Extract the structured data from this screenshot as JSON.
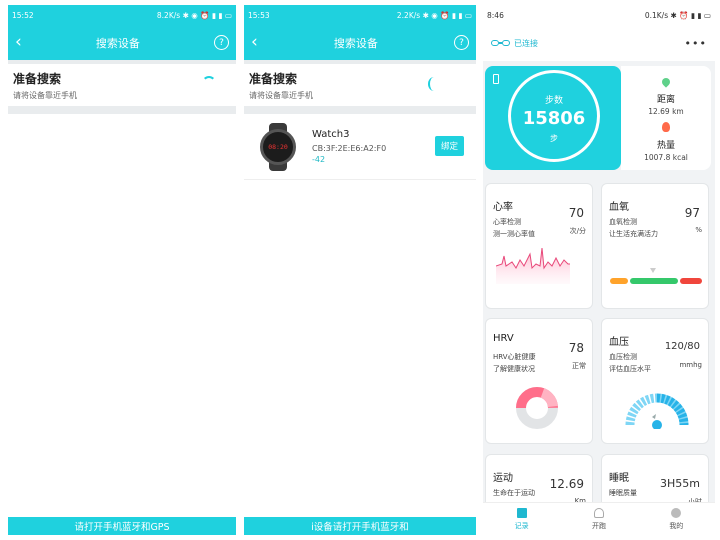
{
  "screen1": {
    "status_time": "15:52",
    "status_right": "8.2K/s ✱ ◉ ⏰ ▮ ▮ ▭",
    "title": "搜索设备",
    "prep_title": "准备搜索",
    "prep_sub": "请将设备靠近手机",
    "bottom_text": "请打开手机蓝牙和GPS"
  },
  "screen2": {
    "status_time": "15:53",
    "status_right": "2.2K/s ✱ ◉ ⏰ ▮ ▮ ▭",
    "title": "搜索设备",
    "prep_title": "准备搜索",
    "prep_sub": "请将设备靠近手机",
    "device": {
      "name": "Watch3",
      "mac": "CB:3F:2E:E6:A2:F0",
      "rssi": "-42",
      "watch_face": "08:20",
      "bind_label": "绑定"
    },
    "bottom_text": "i设备请打开手机蓝牙和"
  },
  "screen3": {
    "status_time": "8:46",
    "status_right": "0.1K/s ✱ ⏰ ▮ ▮ ▭",
    "connected": "已连接",
    "more": "•••",
    "steps": {
      "label": "步数",
      "value": "15806",
      "unit": "步"
    },
    "distance": {
      "label": "距离",
      "value": "12.69 km"
    },
    "calories": {
      "label": "热量",
      "value": "1007.8 kcal"
    },
    "heart_rate": {
      "title": "心率",
      "sub1": "心率检测",
      "sub2": "测一测心率值",
      "value": "70",
      "unit": "次/分"
    },
    "oxygen": {
      "title": "血氧",
      "sub1": "血氧检测",
      "sub2": "让生活充满活力",
      "value": "97",
      "unit": "%"
    },
    "hrv": {
      "title": "HRV",
      "sub1": "HRV心脏健康",
      "sub2": "了解健康状况",
      "value": "78",
      "unit": "正常"
    },
    "blood_pressure": {
      "title": "血压",
      "sub1": "血压检测",
      "sub2": "评估血压水平",
      "value": "120/80",
      "unit": "mmhg"
    },
    "sport": {
      "title": "运动",
      "sub1": "生命在于运动",
      "value": "12.69",
      "unit": "Km"
    },
    "sleep": {
      "title": "睡眠",
      "sub1": "睡眠质量",
      "value": "3H55m",
      "unit": "小时"
    },
    "tabs": [
      {
        "label": "记录"
      },
      {
        "label": "开跑"
      },
      {
        "label": "我的"
      }
    ],
    "colors": {
      "accent": "#1fd1de",
      "hr_line": "#e8487a",
      "o2_orange": "#ffa32b",
      "o2_green": "#35c86b",
      "o2_red": "#f0463c",
      "hrv_pink": "#ff6e8a"
    }
  }
}
